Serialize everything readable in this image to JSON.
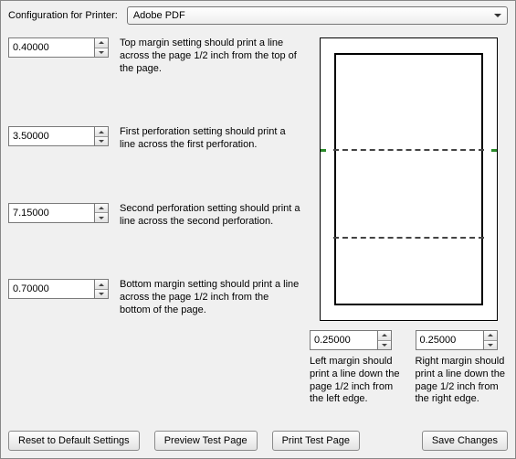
{
  "header": {
    "config_label": "Configuration for Printer:",
    "printer_selected": "Adobe PDF"
  },
  "settings": {
    "top_margin": {
      "value": "0.40000",
      "desc": "Top margin setting should print a line across the page 1/2 inch from the top of the page."
    },
    "first_perforation": {
      "value": "3.50000",
      "desc": "First perforation setting should print a line across the first perforation."
    },
    "second_perforation": {
      "value": "7.15000",
      "desc": "Second perforation setting should print a line across the second perforation."
    },
    "bottom_margin": {
      "value": "0.70000",
      "desc": "Bottom margin setting should print a line across the page 1/2 inch from the bottom of the page."
    },
    "left_margin": {
      "value": "0.25000",
      "desc": "Left margin should print a line down the page 1/2 inch from the left edge."
    },
    "right_margin": {
      "value": "0.25000",
      "desc": "Right margin should print a line down the page 1/2 inch from the right edge."
    }
  },
  "buttons": {
    "reset": "Reset to Default Settings",
    "preview": "Preview Test Page",
    "print": "Print Test Page",
    "save": "Save Changes"
  }
}
